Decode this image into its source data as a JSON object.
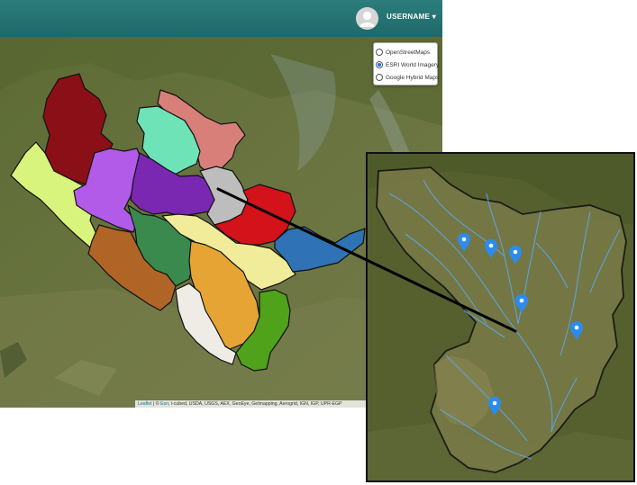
{
  "header": {
    "username": "USERNAME",
    "caret": "▾"
  },
  "layers": [
    {
      "label": "OpenStreetMaps",
      "checked": false
    },
    {
      "label": "ESRI World Imagery",
      "checked": true
    },
    {
      "label": "Google Hybrid Maps",
      "checked": false
    }
  ],
  "attribution": {
    "leaflet": "Leaflet",
    "sep": " | © ",
    "esri": "Esri",
    "rest": ", i-cubed, USDA, USGS, AEX, GeoEye, Getmapping, Aerogrid, IGN, IGP, UPR-EGP"
  },
  "colors": {
    "header": "#23726f",
    "selected_radio": "#1a73e8",
    "marker": "#2b8cf0",
    "river": "#5aa8e6"
  },
  "icons": {
    "avatar": "user-avatar-icon",
    "marker": "map-marker-icon"
  }
}
